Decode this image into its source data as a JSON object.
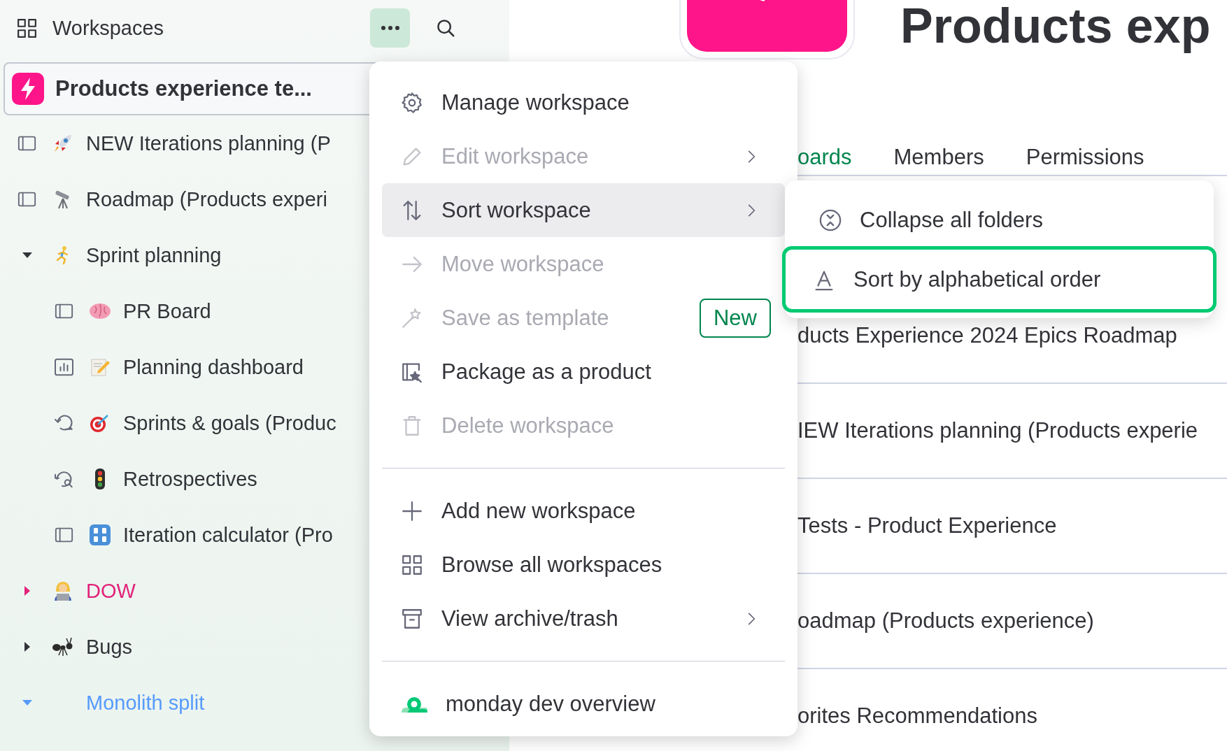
{
  "sidebar": {
    "title": "Workspaces",
    "more_active": true,
    "workspace": {
      "name": "Products experience te..."
    },
    "tree": [
      {
        "kind": "board",
        "label": "NEW Iterations planning (P"
      },
      {
        "kind": "board",
        "label": "Roadmap (Products experi"
      },
      {
        "kind": "folder",
        "label": "Sprint planning",
        "expanded": true,
        "color": "#323338",
        "children": [
          {
            "kind": "board",
            "label": "PR Board"
          },
          {
            "kind": "dashboard",
            "label": "Planning dashboard"
          },
          {
            "kind": "sprints",
            "label": "Sprints & goals (Produc"
          },
          {
            "kind": "retro",
            "label": "Retrospectives"
          },
          {
            "kind": "board",
            "label": "Iteration calculator (Pro"
          }
        ]
      },
      {
        "kind": "folder",
        "label": "DOW",
        "expanded": false,
        "color": "#e2247a"
      },
      {
        "kind": "folder",
        "label": "Bugs",
        "expanded": false,
        "color": "#323338"
      },
      {
        "kind": "folder",
        "label": "Monolith split",
        "expanded": true,
        "color": "#579bfc"
      }
    ]
  },
  "main": {
    "title": "Products exp",
    "tabs": [
      {
        "label": "oards",
        "selected": true
      },
      {
        "label": "Members",
        "selected": false
      },
      {
        "label": "Permissions",
        "selected": false
      }
    ],
    "rows": [
      "ducts Experience 2024 Epics Roadmap",
      "IEW Iterations planning (Products experie",
      "Tests - Product Experience",
      "oadmap (Products experience)",
      "orites Recommendations"
    ]
  },
  "menu": {
    "items": [
      {
        "kind": "item",
        "label": "Manage workspace",
        "disabled": false,
        "selected": false,
        "submenu": false
      },
      {
        "kind": "item",
        "label": "Edit workspace",
        "disabled": true,
        "selected": false,
        "submenu": true
      },
      {
        "kind": "item",
        "label": "Sort workspace",
        "disabled": false,
        "selected": true,
        "submenu": true
      },
      {
        "kind": "item",
        "label": "Move workspace",
        "disabled": true,
        "selected": false,
        "submenu": false
      },
      {
        "kind": "item",
        "label": "Save as template",
        "disabled": true,
        "selected": false,
        "submenu": false,
        "badge": "New"
      },
      {
        "kind": "item",
        "label": "Package as a product",
        "disabled": false,
        "selected": false,
        "submenu": false
      },
      {
        "kind": "item",
        "label": "Delete workspace",
        "disabled": true,
        "selected": false,
        "submenu": false
      },
      {
        "kind": "divider"
      },
      {
        "kind": "item",
        "label": "Add new workspace",
        "disabled": false,
        "selected": false,
        "submenu": false
      },
      {
        "kind": "item",
        "label": "Browse all workspaces",
        "disabled": false,
        "selected": false,
        "submenu": false
      },
      {
        "kind": "item",
        "label": "View archive/trash",
        "disabled": false,
        "selected": false,
        "submenu": true
      },
      {
        "kind": "divider"
      },
      {
        "kind": "item",
        "label": "monday dev overview",
        "disabled": false,
        "selected": false,
        "submenu": false
      }
    ]
  },
  "submenu": {
    "items": [
      {
        "label": "Collapse all folders",
        "selected": false
      },
      {
        "label": "Sort by alphabetical order",
        "selected": true
      }
    ]
  }
}
